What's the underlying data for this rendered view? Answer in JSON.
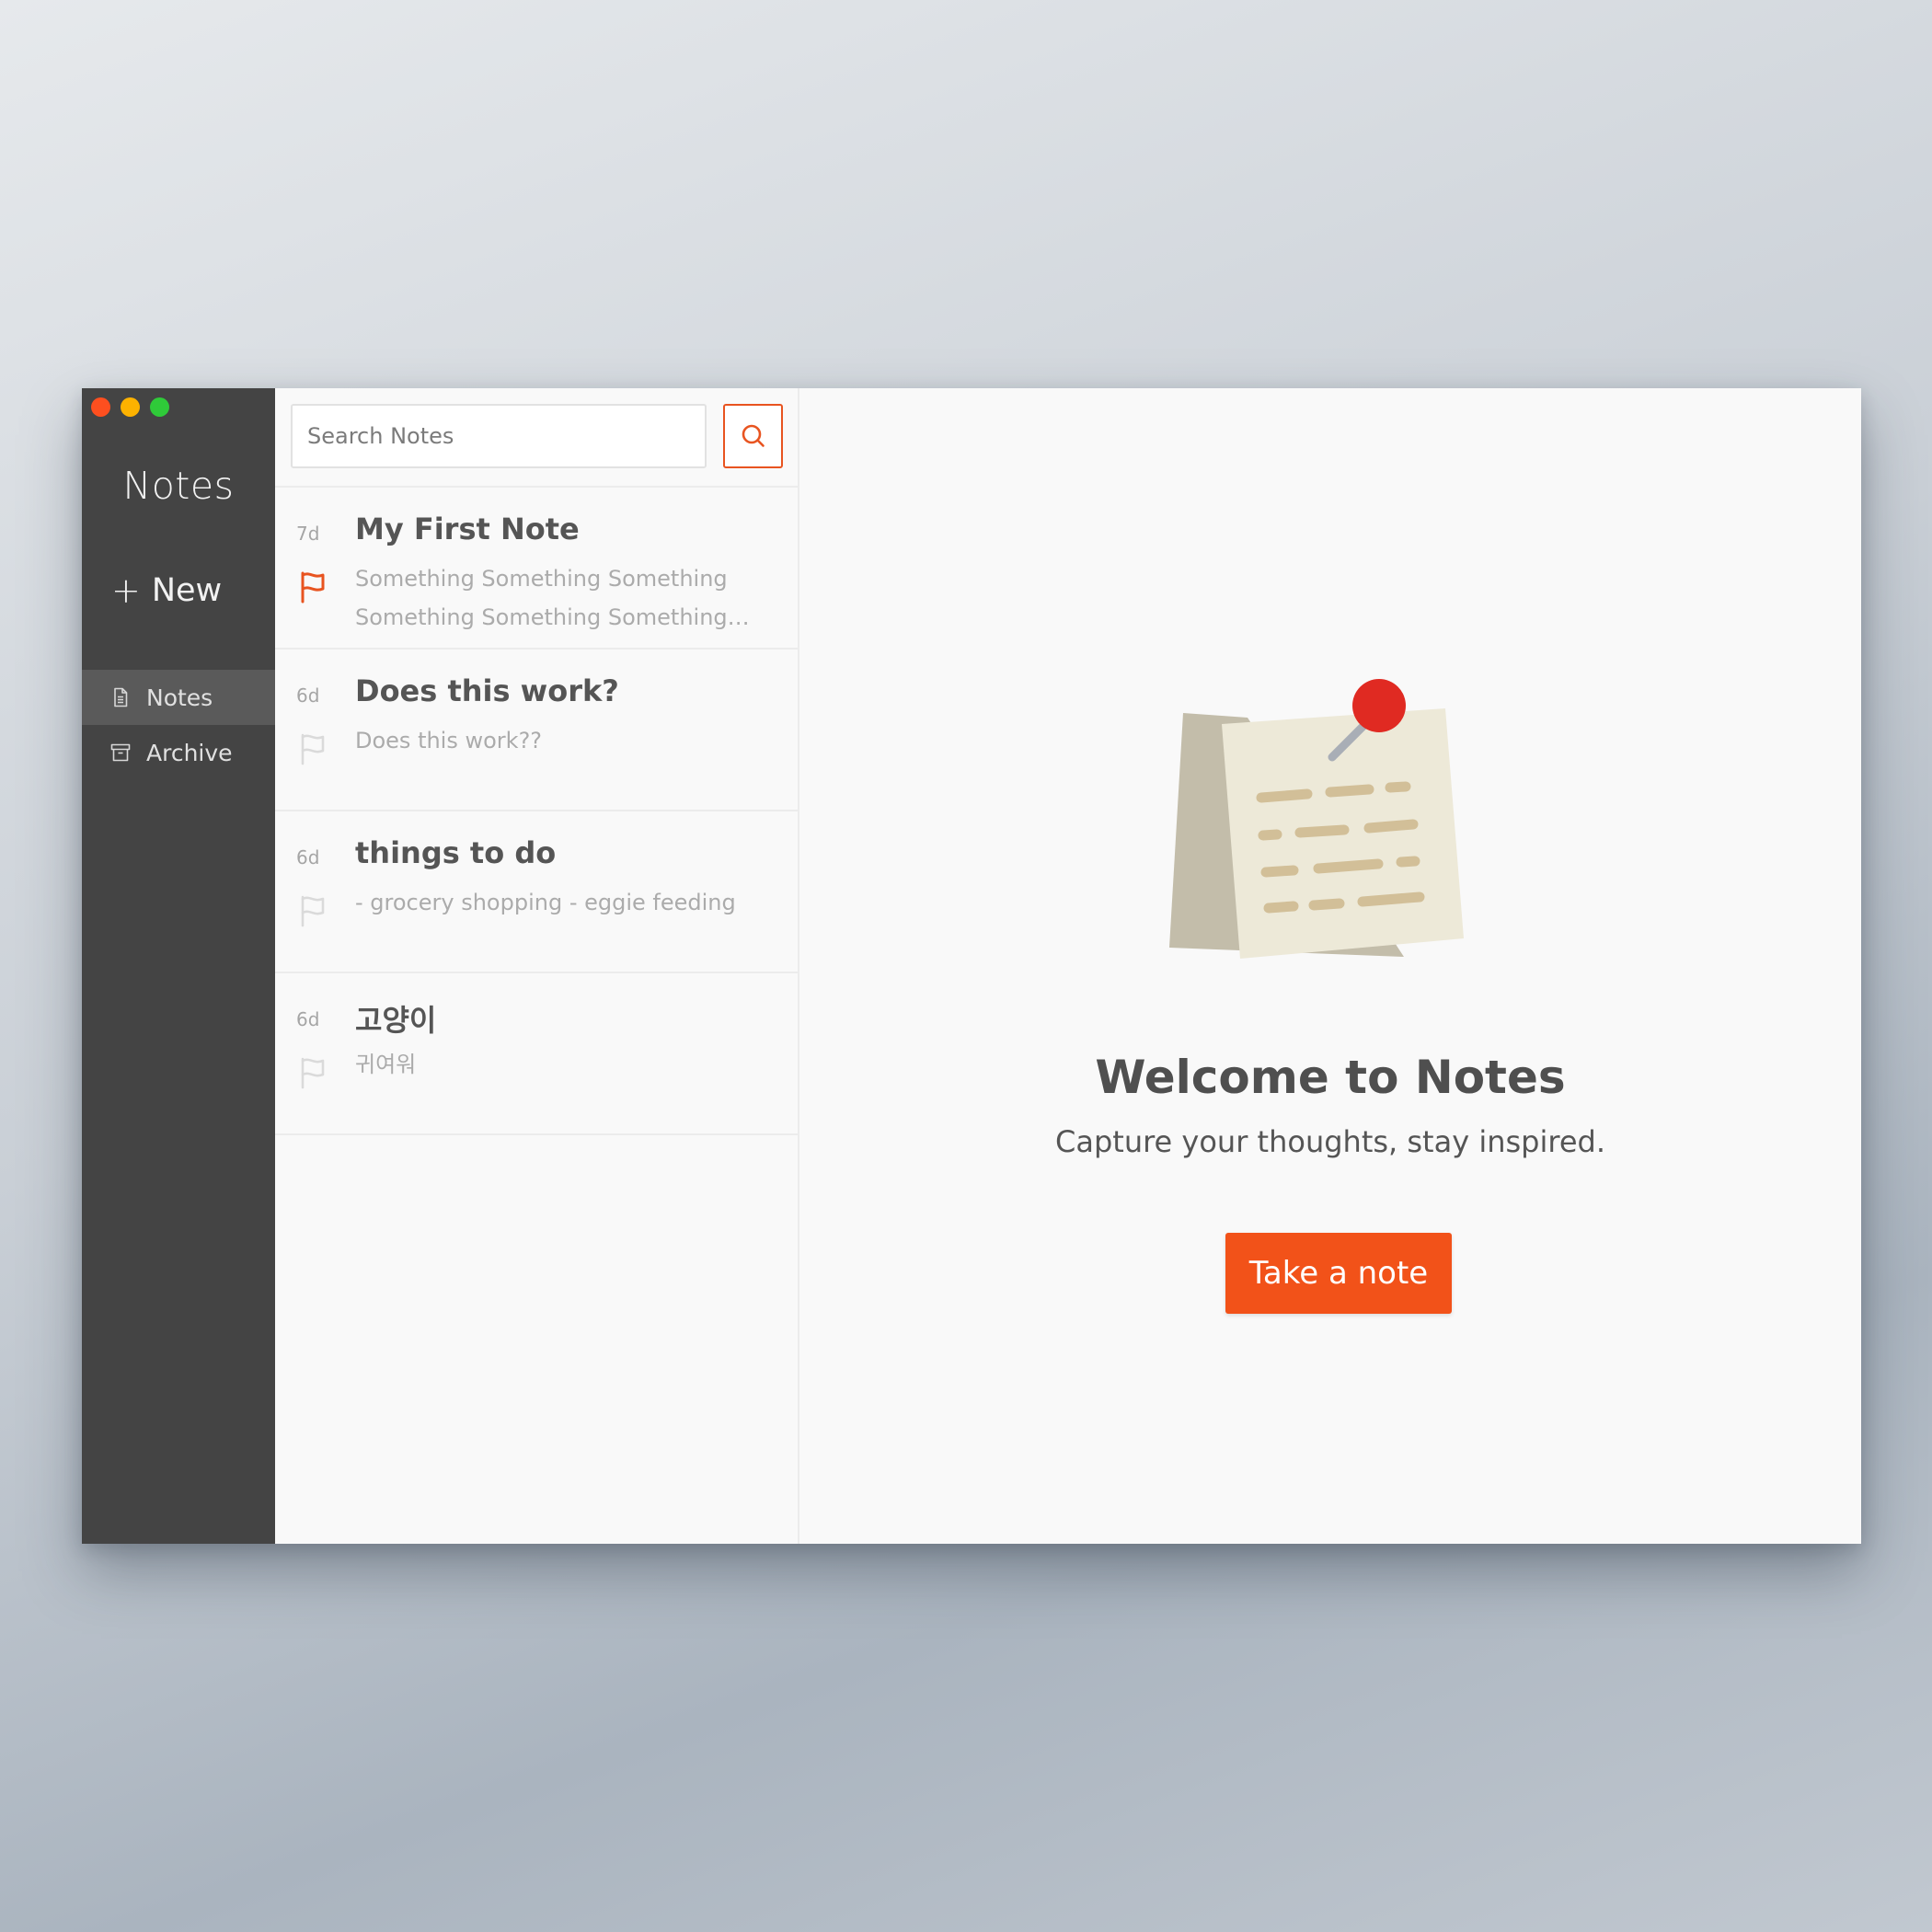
{
  "window": {
    "traffic_lights": [
      "#fe4f1f",
      "#fdb200",
      "#2fca39"
    ]
  },
  "sidebar": {
    "title": "Notes",
    "new_label": "New",
    "items": [
      {
        "label": "Notes",
        "icon": "document-icon",
        "active": true
      },
      {
        "label": "Archive",
        "icon": "archive-icon",
        "active": false
      }
    ]
  },
  "search": {
    "placeholder": "Search Notes",
    "value": ""
  },
  "notes": [
    {
      "age": "7d",
      "title": "My First Note",
      "preview": "Something Something Something Something Something Something So...",
      "flagged": true
    },
    {
      "age": "6d",
      "title": "Does this work?",
      "preview": "Does this work??",
      "flagged": false
    },
    {
      "age": "6d",
      "title": "things to do",
      "preview": "- grocery shopping - eggie feeding",
      "flagged": false
    },
    {
      "age": "6d",
      "title": "고양이",
      "preview": "귀여워",
      "flagged": false
    }
  ],
  "main": {
    "welcome_title": "Welcome to Notes",
    "welcome_subtitle": "Capture your thoughts, stay inspired.",
    "cta_label": "Take a note",
    "accent_color": "#f25219"
  }
}
